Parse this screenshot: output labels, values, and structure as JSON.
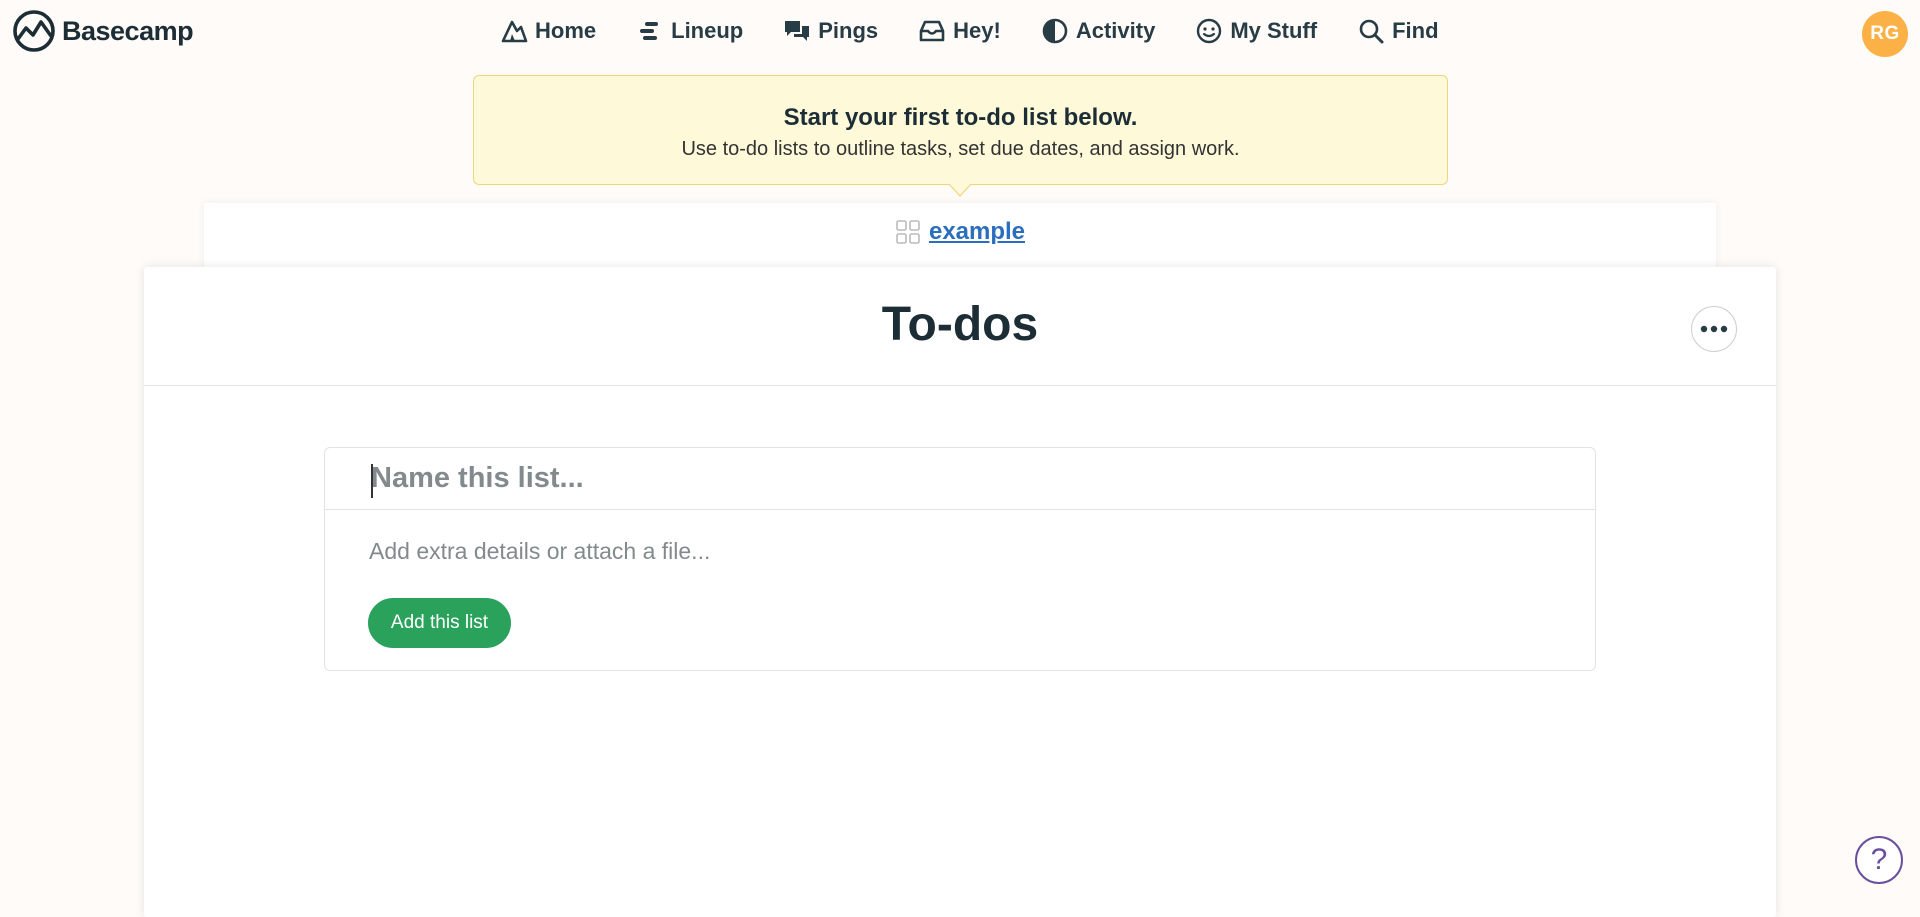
{
  "app": {
    "name": "Basecamp",
    "accent": "#2aa25b",
    "link_color": "#2a6ebd",
    "avatar_color": "#fbb145"
  },
  "nav": {
    "items": [
      {
        "label": "Home",
        "icon": "home-icon"
      },
      {
        "label": "Lineup",
        "icon": "lineup-icon"
      },
      {
        "label": "Pings",
        "icon": "pings-icon"
      },
      {
        "label": "Hey!",
        "icon": "hey-icon"
      },
      {
        "label": "Activity",
        "icon": "activity-icon"
      },
      {
        "label": "My Stuff",
        "icon": "my-stuff-icon"
      },
      {
        "label": "Find",
        "icon": "search-icon"
      }
    ]
  },
  "user": {
    "initials": "RG"
  },
  "callout": {
    "title": "Start your first to-do list below.",
    "body": "Use to-do lists to outline tasks, set due dates, and assign work."
  },
  "project": {
    "name": "example",
    "icon": "grid-icon"
  },
  "page": {
    "title": "To-dos",
    "more_icon": "ellipsis-icon"
  },
  "form": {
    "name_placeholder": "Name this list...",
    "details_placeholder": "Add extra details or attach a file...",
    "submit_label": "Add this list"
  },
  "help": {
    "label": "?"
  }
}
